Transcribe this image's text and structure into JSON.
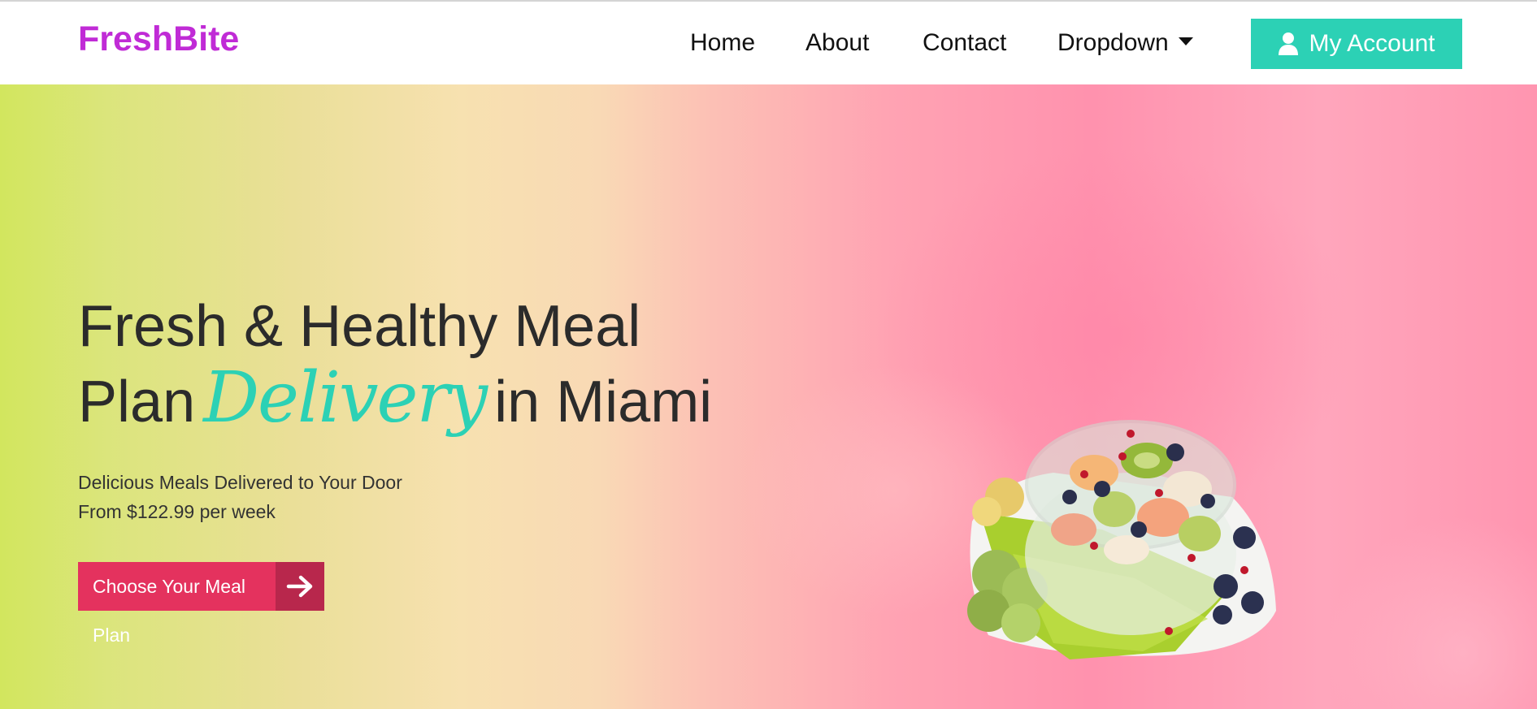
{
  "brand": {
    "name": "FreshBite",
    "color": "#c02bd6"
  },
  "nav": {
    "items": [
      {
        "label": "Home"
      },
      {
        "label": "About"
      },
      {
        "label": "Contact"
      },
      {
        "label": "Dropdown",
        "icon": "caret-down-icon"
      }
    ]
  },
  "account": {
    "label": "My Account",
    "icon": "user-icon",
    "color": "#2cd1b5"
  },
  "hero": {
    "title_line1": "Fresh & Healthy Meal",
    "title_line2_prefix": "Plan",
    "title_accent": "Delivery",
    "title_line2_suffix": "in Miami",
    "accent_color": "#2cd1b5",
    "subtitle_1": "Delicious Meals Delivered to Your Door",
    "subtitle_2": "From $122.99 per week",
    "cta_label": "Choose Your Meal Plan",
    "cta_icon": "arrow-right-icon",
    "cta_color": "#e4325e"
  },
  "image": {
    "subject": "fruit-salad-bowl"
  }
}
